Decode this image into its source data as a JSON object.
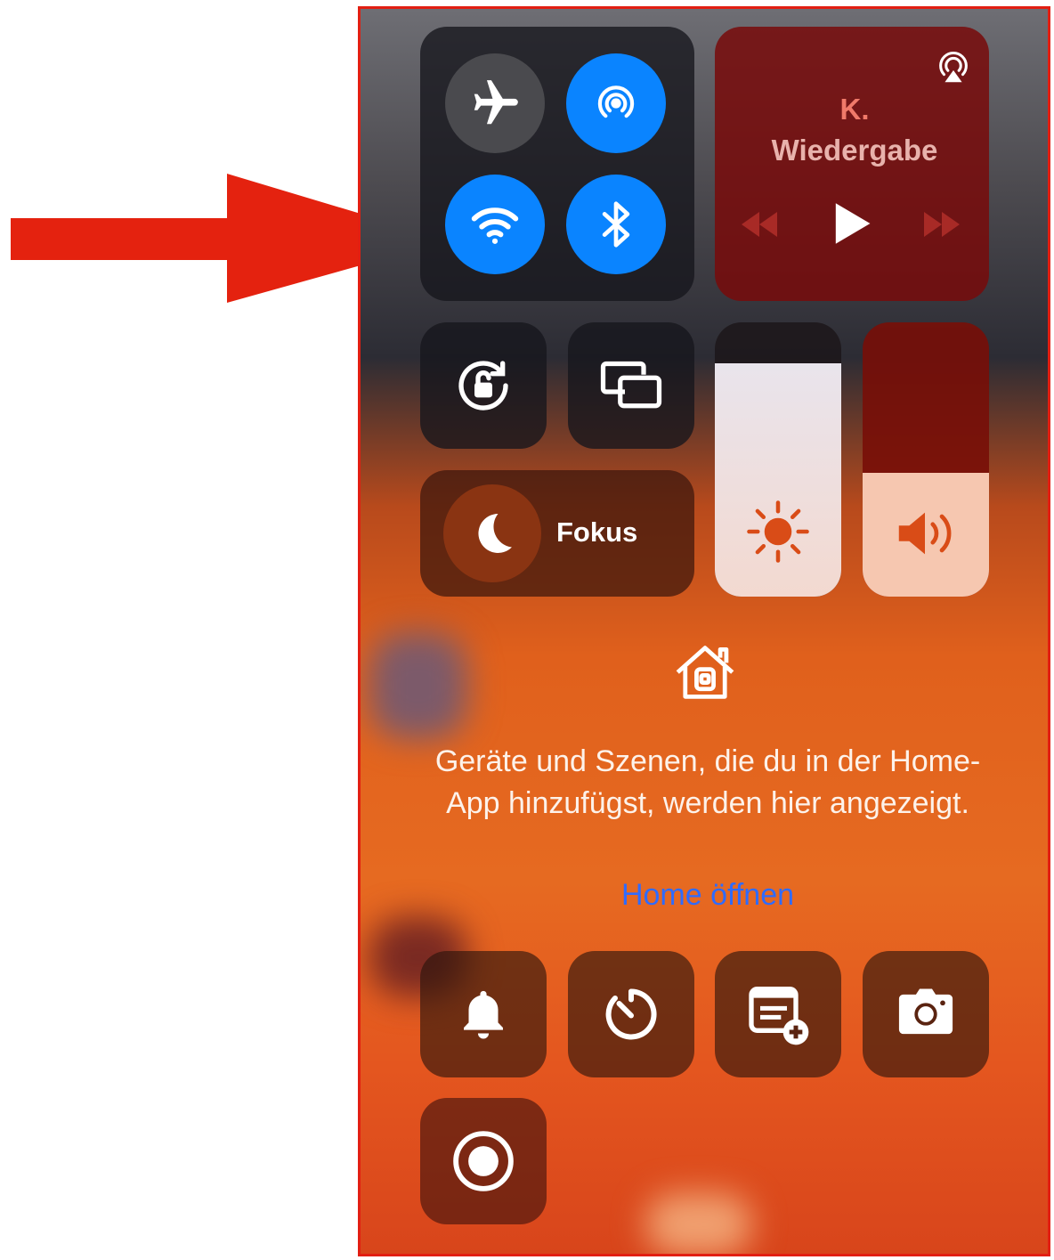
{
  "media": {
    "title_line1": "K.",
    "title_line2": "Wiedergabe",
    "airplay_icon": "airplay-icon",
    "controls": [
      "rewind-icon",
      "play-icon",
      "forward-icon"
    ]
  },
  "connectivity": {
    "airplane_mode": {
      "icon": "airplane-icon",
      "state": "off"
    },
    "airdrop": {
      "icon": "airdrop-icon",
      "state": "on"
    },
    "wifi": {
      "icon": "wifi-icon",
      "state": "on"
    },
    "bluetooth": {
      "icon": "bluetooth-icon",
      "state": "on"
    }
  },
  "toggles": {
    "orientation_lock": "orientation-lock-icon",
    "screen_mirroring": "screen-mirroring-icon"
  },
  "focus": {
    "label": "Fokus",
    "icon": "moon-icon"
  },
  "sliders": {
    "brightness": {
      "icon": "sun-icon",
      "level": 0.85
    },
    "volume": {
      "icon": "speaker-icon",
      "level": 0.45
    }
  },
  "home": {
    "icon": "home-icon",
    "text": "Geräte und Szenen, die du in der Home-App hinzufügst, werden hier angezeigt.",
    "link": "Home öffnen"
  },
  "bottom_controls": [
    "bell-icon",
    "timer-icon",
    "notes-add-icon",
    "camera-icon",
    "screen-record-icon"
  ],
  "colors": {
    "accent_blue": "#0a84ff",
    "arrow_red": "#e4220f",
    "link_blue": "#2f6bff"
  }
}
